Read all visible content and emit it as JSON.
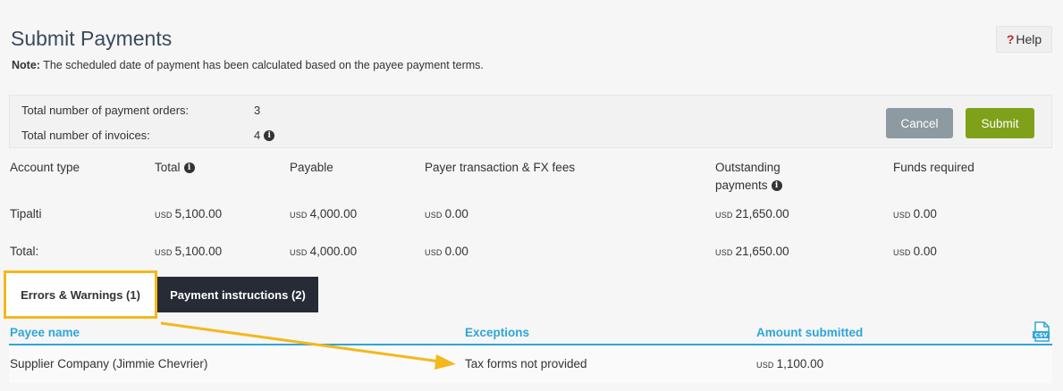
{
  "header": {
    "title": "Submit Payments",
    "note_label": "Note:",
    "note_text": "The scheduled date of payment has been calculated based on the payee payment terms.",
    "help_q": "?",
    "help_label": "Help"
  },
  "summary": {
    "orders_label": "Total number of payment orders:",
    "orders_value": "3",
    "invoices_label": "Total number of invoices:",
    "invoices_value": "4"
  },
  "actions": {
    "cancel_label": "Cancel",
    "submit_label": "Submit"
  },
  "accounts_table": {
    "headers": {
      "account_type": "Account type",
      "total": "Total",
      "payable": "Payable",
      "fees": "Payer transaction & FX fees",
      "outstanding_1": "Outstanding",
      "outstanding_2": "payments",
      "funds": "Funds required"
    },
    "rows": [
      {
        "account_type": "Tipalti",
        "total": "5,100.00",
        "payable": "4,000.00",
        "fees": "0.00",
        "outstanding": "21,650.00",
        "funds": "0.00"
      },
      {
        "account_type": "Total:",
        "total": "5,100.00",
        "payable": "4,000.00",
        "fees": "0.00",
        "outstanding": "21,650.00",
        "funds": "0.00"
      }
    ],
    "currency": "USD"
  },
  "tabs": {
    "errors_label": "Errors & Warnings (1)",
    "payment_label": "Payment instructions (2)"
  },
  "errors_table": {
    "headers": {
      "payee": "Payee name",
      "exceptions": "Exceptions",
      "amount": "Amount submitted"
    },
    "csv_text": "CSV",
    "rows": [
      {
        "payee": "Supplier Company (Jimmie Chevrier)",
        "exception": "Tax forms not provided",
        "currency": "USD",
        "amount": "1,100.00"
      }
    ]
  },
  "colors": {
    "accent_blue": "#2fa5d8",
    "submit_green": "#7fa11a",
    "cancel_grey": "#8e9aa1",
    "highlight_yellow": "#f4b81c",
    "dark_tab": "#262b35",
    "help_red": "#d0201f"
  }
}
